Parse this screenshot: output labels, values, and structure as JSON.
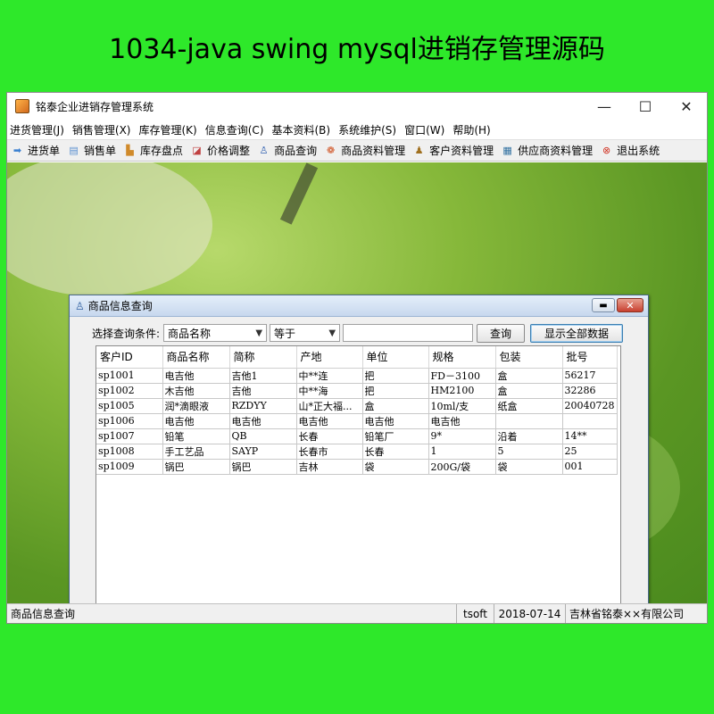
{
  "banner": "1034-java swing mysql进销存管理源码",
  "window": {
    "title": "铭泰企业进销存管理系统",
    "minimize": "—",
    "maximize": "☐",
    "close": "✕"
  },
  "menu": [
    "进货管理(J)",
    "销售管理(X)",
    "库存管理(K)",
    "信息查询(C)",
    "基本资料(B)",
    "系统维护(S)",
    "窗口(W)",
    "帮助(H)"
  ],
  "toolbar": [
    {
      "label": "进货单",
      "icon": "import-icon",
      "color": "#3a7fd0",
      "glyph": "➡"
    },
    {
      "label": "销售单",
      "icon": "document-icon",
      "color": "#5a8fd0",
      "glyph": "▤"
    },
    {
      "label": "库存盘点",
      "icon": "inventory-icon",
      "color": "#d08a2a",
      "glyph": "▙"
    },
    {
      "label": "价格调整",
      "icon": "price-chart-icon",
      "color": "#c04040",
      "glyph": "◪"
    },
    {
      "label": "商品查询",
      "icon": "user-search-icon",
      "color": "#3060b0",
      "glyph": "♙"
    },
    {
      "label": "商品资料管理",
      "icon": "goods-icon",
      "color": "#d05020",
      "glyph": "❁"
    },
    {
      "label": "客户资料管理",
      "icon": "customer-icon",
      "color": "#a07020",
      "glyph": "♟"
    },
    {
      "label": "供应商资料管理",
      "icon": "supplier-icon",
      "color": "#3070a0",
      "glyph": "▦"
    },
    {
      "label": "退出系统",
      "icon": "exit-icon",
      "color": "#d03020",
      "glyph": "⊗"
    }
  ],
  "dialog": {
    "title": "商品信息查询",
    "query_label": "选择查询条件:",
    "field_select": "商品名称",
    "operator_select": "等于",
    "query_value": "",
    "query_button": "查询",
    "show_all_button": "显示全部数据",
    "columns": [
      "客户ID",
      "商品名称",
      "简称",
      "产地",
      "单位",
      "规格",
      "包装",
      "批号"
    ],
    "rows": [
      [
        "sp1001",
        "电吉他",
        "吉他1",
        "中**连",
        "把",
        "FD－3100",
        "盒",
        "56217"
      ],
      [
        "sp1002",
        "木吉他",
        "吉他",
        "中**海",
        "把",
        "HM2100",
        "盒",
        "32286"
      ],
      [
        "sp1005",
        "润*滴眼液",
        "RZDYY",
        "山*正大福...",
        "盒",
        "10ml/支",
        "纸盒",
        "20040728"
      ],
      [
        "sp1006",
        "电吉他",
        "电吉他",
        "电吉他",
        "电吉他",
        "电吉他",
        "",
        ""
      ],
      [
        "sp1007",
        "铅笔",
        "QB",
        "长春",
        "铅笔厂",
        "9*",
        "沿着",
        "14**"
      ],
      [
        "sp1008",
        "手工艺品",
        "SAYP",
        "长春市",
        "长春",
        "1",
        "5",
        "25"
      ],
      [
        "sp1009",
        "锅巴",
        "锅巴",
        "吉林",
        "袋",
        "200G/袋",
        "袋",
        "001"
      ]
    ]
  },
  "status": {
    "left": "商品信息查询",
    "user": "tsoft",
    "date": "2018-07-14",
    "company": "吉林省铭泰××有限公司"
  }
}
